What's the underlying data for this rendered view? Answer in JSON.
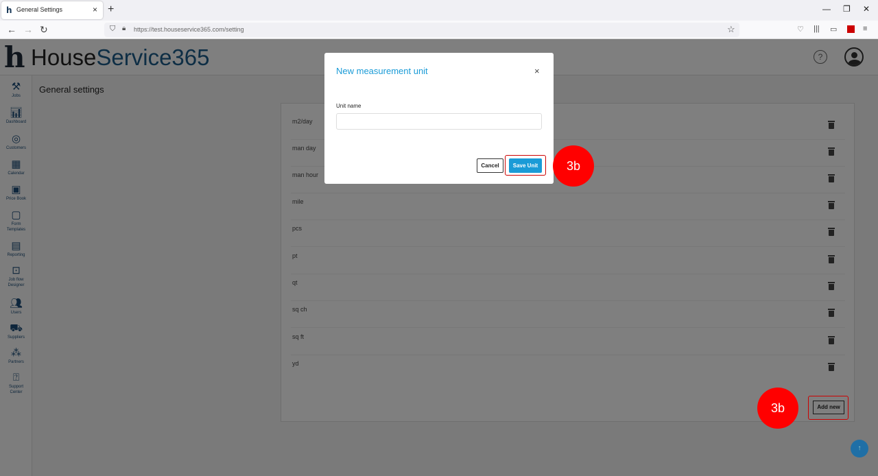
{
  "browser": {
    "tab_title": "General Settings",
    "tab_close": "×",
    "new_tab": "+",
    "url": "https://test.houseservice365.com/setting",
    "win_minimize": "—",
    "win_restore": "❐",
    "win_close": "✕"
  },
  "app": {
    "logo_word1": "House",
    "logo_word2": "Service365"
  },
  "sidebar": {
    "items": [
      {
        "label": "Jobs",
        "icon": "tools-icon"
      },
      {
        "label": "Dashboard",
        "icon": "chart-icon"
      },
      {
        "label": "Customers",
        "icon": "customers-icon"
      },
      {
        "label": "Calendar",
        "icon": "calendar-icon"
      },
      {
        "label": "Price Book",
        "icon": "price-book-icon"
      },
      {
        "label": "Form",
        "label2": "Templates",
        "icon": "form-icon"
      },
      {
        "label": "Reporting",
        "icon": "report-icon"
      },
      {
        "label": "Job flow",
        "label2": "Designer",
        "icon": "flow-icon"
      },
      {
        "label": "Users",
        "icon": "users-icon"
      },
      {
        "label": "Suppliers",
        "icon": "truck-icon"
      },
      {
        "label": "Partners",
        "icon": "partners-icon"
      },
      {
        "label": "Support",
        "label2": "Center",
        "icon": "help-icon"
      }
    ]
  },
  "main": {
    "page_title": "General settings",
    "units": [
      "m2/day",
      "man day",
      "man hour",
      "mile",
      "pcs",
      "pt",
      "qt",
      "sq ch",
      "sq ft",
      "yd"
    ],
    "add_new_label": "Add new"
  },
  "modal": {
    "title": "New measurement unit",
    "close": "×",
    "field_label": "Unit name",
    "field_value": "",
    "cancel_label": "Cancel",
    "save_label": "Save Unit"
  },
  "callouts": {
    "save": "3b",
    "add": "3b"
  },
  "scroll_top": "↑",
  "colors": {
    "accent": "#1a9bd7",
    "highlight": "#cc0000",
    "callout": "#ff0000"
  }
}
